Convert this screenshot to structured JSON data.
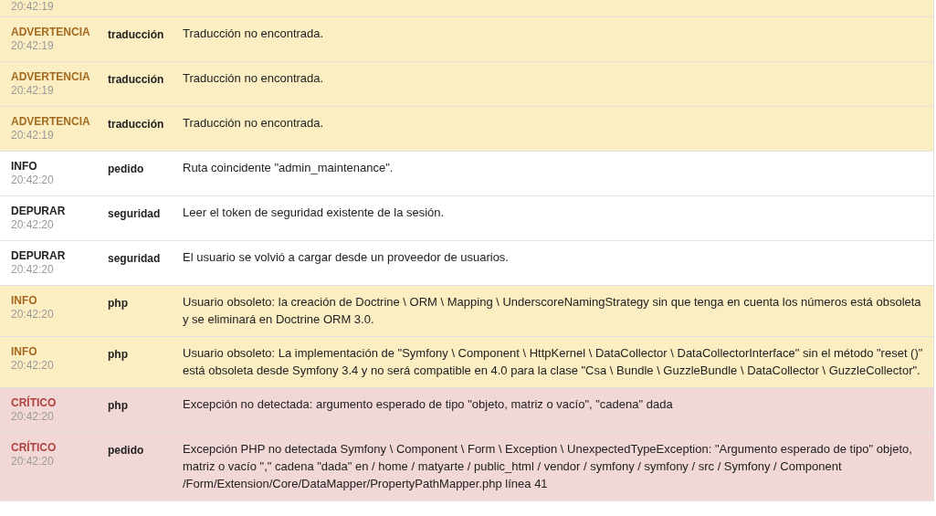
{
  "log_rows": [
    {
      "kind": "cut",
      "time": "20:42:19"
    },
    {
      "kind": "warning",
      "level": "ADVERTENCIA",
      "time": "20:42:19",
      "channel": "traducción",
      "message": "Traducción no encontrada."
    },
    {
      "kind": "warning",
      "level": "ADVERTENCIA",
      "time": "20:42:19",
      "channel": "traducción",
      "message": "Traducción no encontrada."
    },
    {
      "kind": "warning",
      "level": "ADVERTENCIA",
      "time": "20:42:19",
      "channel": "traducción",
      "message": "Traducción no encontrada."
    },
    {
      "kind": "plain",
      "level": "INFO",
      "time": "20:42:20",
      "channel": "pedido",
      "message": "Ruta coincidente \"admin_maintenance\"."
    },
    {
      "kind": "plain",
      "level": "DEPURAR",
      "time": "20:42:20",
      "channel": "seguridad",
      "message": "Leer el token de seguridad existente de la sesión."
    },
    {
      "kind": "plain",
      "level": "DEPURAR",
      "time": "20:42:20",
      "channel": "seguridad",
      "message": "El usuario se volvió a cargar desde un proveedor de usuarios."
    },
    {
      "kind": "warning",
      "level": "INFO",
      "time": "20:42:20",
      "channel": "php",
      "message": "Usuario obsoleto: la creación de Doctrine \\ ORM \\ Mapping \\ UnderscoreNamingStrategy sin que tenga en cuenta los números está obsoleta y se eliminará en Doctrine ORM 3.0."
    },
    {
      "kind": "warning",
      "level": "INFO",
      "time": "20:42:20",
      "channel": "php",
      "message": "Usuario obsoleto: La implementación de \"Symfony \\ Component \\ HttpKernel \\ DataCollector \\ DataCollectorInterface\" sin el método \"reset ()\" está obsoleta desde Symfony 3.4 y no será compatible en 4.0 para la clase \"Csa \\ Bundle \\ GuzzleBundle \\ DataCollector \\ GuzzleCollector\"."
    },
    {
      "kind": "error",
      "level": "CRÍTICO",
      "time": "20:42:20",
      "channel": "php",
      "message": "Excepción no detectada: argumento esperado de tipo \"objeto, matriz o vacío\", \"cadena\" dada"
    },
    {
      "kind": "error",
      "level": "CRÍTICO",
      "time": "20:42:20",
      "channel": "pedido",
      "message": "Excepción PHP no detectada Symfony \\ Component \\ Form \\ Exception \\ UnexpectedTypeException: \"Argumento esperado de tipo\" objeto, matriz o vacío \",\" cadena \"dada\" en / home / matyarte / public_html / vendor / symfony / symfony / src / Symfony / Component /Form/Extension/Core/DataMapper/PropertyPathMapper.php línea 41"
    }
  ]
}
